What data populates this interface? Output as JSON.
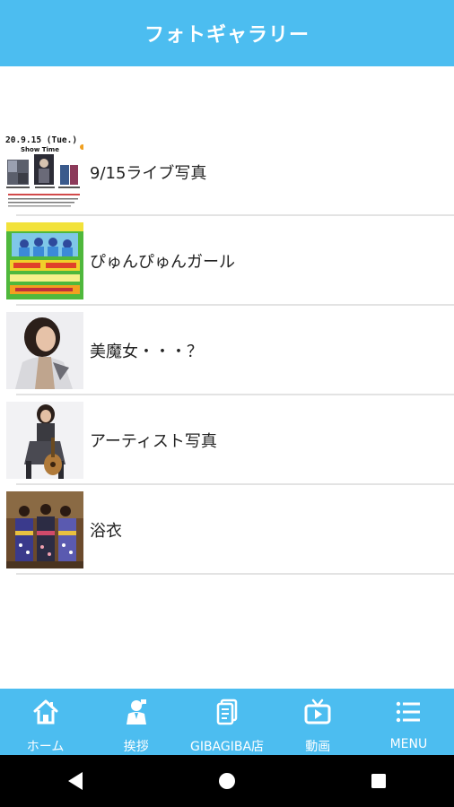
{
  "header": {
    "title": "フォトギャラリー"
  },
  "gallery": {
    "items": [
      {
        "label": "9/15ライブ写真",
        "thumb_text": "20.9.15 (Tue.)",
        "thumb_sub": "Show Time"
      },
      {
        "label": "ぴゅんぴゅんガール"
      },
      {
        "label": "美魔女・・・？"
      },
      {
        "label": "アーティスト写真"
      },
      {
        "label": "浴衣"
      }
    ]
  },
  "tabbar": {
    "tabs": [
      {
        "label": "ホーム",
        "icon": "home-icon"
      },
      {
        "label": "挨拶",
        "icon": "greeting-person-icon"
      },
      {
        "label": "GIBAGIBA店",
        "icon": "document-icon"
      },
      {
        "label": "動画",
        "icon": "tv-icon"
      },
      {
        "label": "MENU",
        "icon": "menu-list-icon"
      }
    ]
  },
  "colors": {
    "accent": "#4cbdf0",
    "divider": "#e3e3e3",
    "system_bar": "#000000"
  }
}
